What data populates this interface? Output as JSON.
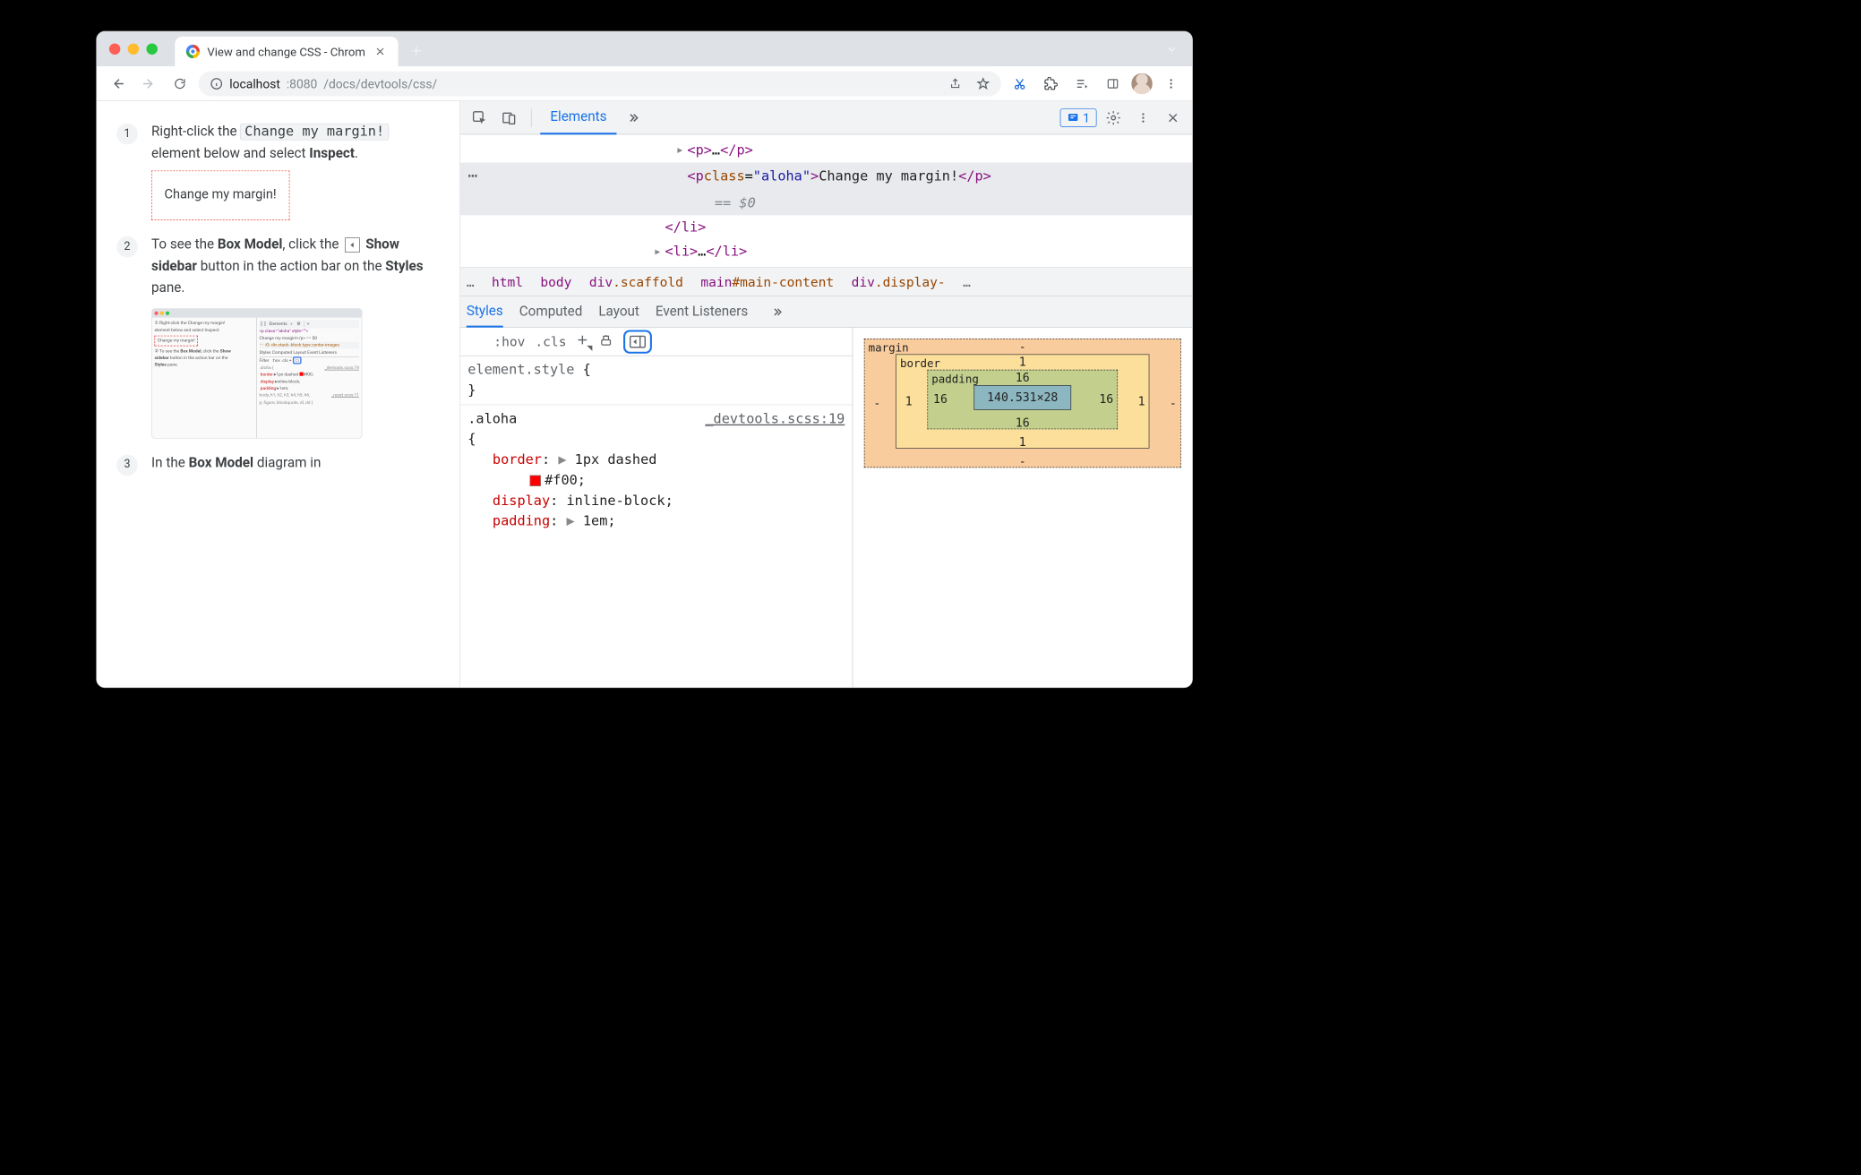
{
  "browser": {
    "tab_title": "View and change CSS - Chrom",
    "url_host": "localhost",
    "url_port": ":8080",
    "url_path": "/docs/devtools/css/"
  },
  "doc": {
    "step1_a": "Right-click the ",
    "step1_code": "Change my margin!",
    "step1_b": " element below and select ",
    "step1_bold": "Inspect",
    "step1_c": ".",
    "demo_text": "Change my margin!",
    "step2_a": "To see the ",
    "step2_bold1": "Box Model",
    "step2_b": ", click the ",
    "step2_bold2": "Show sidebar",
    "step2_c": " button in the action bar on the ",
    "step2_bold3": "Styles",
    "step2_d": " pane.",
    "step3_a": "In the ",
    "step3_bold": "Box Model",
    "step3_b": " diagram in"
  },
  "devtools": {
    "tabs": {
      "elements": "Elements"
    },
    "issues_count": "1",
    "dom": {
      "row1": {
        "open": "<p>",
        "dots": "…",
        "close": "</p>"
      },
      "row2": {
        "open": "<p ",
        "attrn": "class",
        "eq": "=",
        "attrv": "\"aloha\"",
        "close1": ">",
        "text": "Change my margin!",
        "close2": "</p>"
      },
      "eq0": "== $0",
      "row3": "</li>",
      "row4": {
        "open": "<li>",
        "dots": "…",
        "close": "</li>"
      }
    },
    "crumb": {
      "i0": "…",
      "i1": "html",
      "i2": "body",
      "i3a": "div",
      "i3b": ".scaffold",
      "i4a": "main",
      "i4b": "#main-content",
      "i5a": "div",
      "i5b": ".display-",
      "i6": "…"
    },
    "subtabs": {
      "styles": "Styles",
      "computed": "Computed",
      "layout": "Layout",
      "listeners": "Event Listeners"
    },
    "styles_toolbar": {
      "hov": ":hov",
      "cls": ".cls"
    },
    "rules": {
      "r0_sel": "element.style",
      "r0_open": " {",
      "r0_close": "}",
      "r1_sel": ".aloha",
      "r1_src": "_devtools.scss:19",
      "r1_open": " {",
      "p1_name": "border",
      "p1_val": " 1px dashed",
      "p1b_val": "#f00",
      "p2_name": "display",
      "p2_val": " inline-block",
      "p3_name": "padding",
      "p3_val": " 1em"
    },
    "boxmodel": {
      "margin_label": "margin",
      "margin_t": "-",
      "margin_r": "-",
      "margin_b": "-",
      "margin_l": "-",
      "border_label": "border",
      "border_t": "1",
      "border_r": "1",
      "border_b": "1",
      "border_l": "1",
      "padding_label": "padding",
      "padding_t": "16",
      "padding_r": "16",
      "padding_b": "16",
      "padding_l": "16",
      "content": "140.531×28"
    }
  }
}
